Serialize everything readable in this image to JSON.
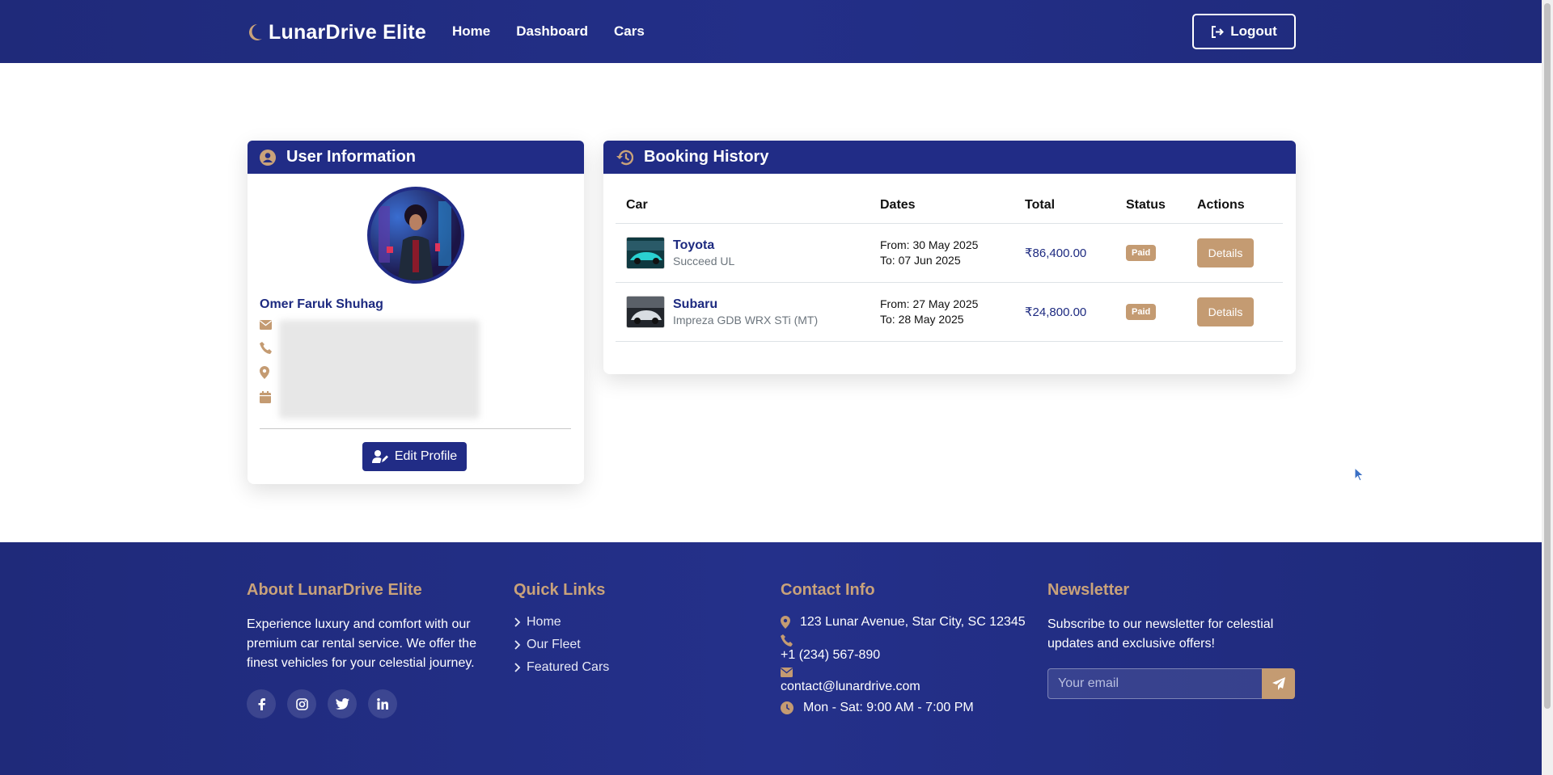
{
  "nav": {
    "brand": "LunarDrive Elite",
    "links": [
      "Home",
      "Dashboard",
      "Cars"
    ],
    "logout": "Logout"
  },
  "user": {
    "header": "User Information",
    "name": "Omer Faruk Shuhag",
    "edit_button": "Edit Profile",
    "icons": [
      "envelope-icon",
      "phone-icon",
      "map-marker-icon",
      "calendar-icon"
    ]
  },
  "bookings": {
    "header": "Booking History",
    "columns": [
      "Car",
      "Dates",
      "Total",
      "Status",
      "Actions"
    ],
    "rows": [
      {
        "make": "Toyota",
        "model": "Succeed UL",
        "from": "From: 30 May 2025",
        "to": "To: 07 Jun 2025",
        "total": "₹86,400.00",
        "status": "Paid",
        "action": "Details"
      },
      {
        "make": "Subaru",
        "model": "Impreza GDB WRX STi (MT)",
        "from": "From: 27 May 2025",
        "to": "To: 28 May 2025",
        "total": "₹24,800.00",
        "status": "Paid",
        "action": "Details"
      }
    ]
  },
  "footer": {
    "about": {
      "title": "About LunarDrive Elite",
      "text": "Experience luxury and comfort with our premium car rental service. We offer the finest vehicles for your celestial journey.",
      "socials": [
        "facebook-icon",
        "instagram-icon",
        "twitter-icon",
        "linkedin-icon"
      ]
    },
    "quick_links": {
      "title": "Quick Links",
      "items": [
        "Home",
        "Our Fleet",
        "Featured Cars"
      ]
    },
    "contact": {
      "title": "Contact Info",
      "address": "123 Lunar Avenue, Star City, SC 12345",
      "phone": "+1 (234) 567-890",
      "email": "contact@lunardrive.com",
      "hours": "Mon - Sat: 9:00 AM - 7:00 PM"
    },
    "newsletter": {
      "title": "Newsletter",
      "text": "Subscribe to our newsletter for celestial updates and exclusive offers!",
      "placeholder": "Your email"
    }
  },
  "colors": {
    "primary": "#212c86",
    "accent": "#c49b72"
  }
}
